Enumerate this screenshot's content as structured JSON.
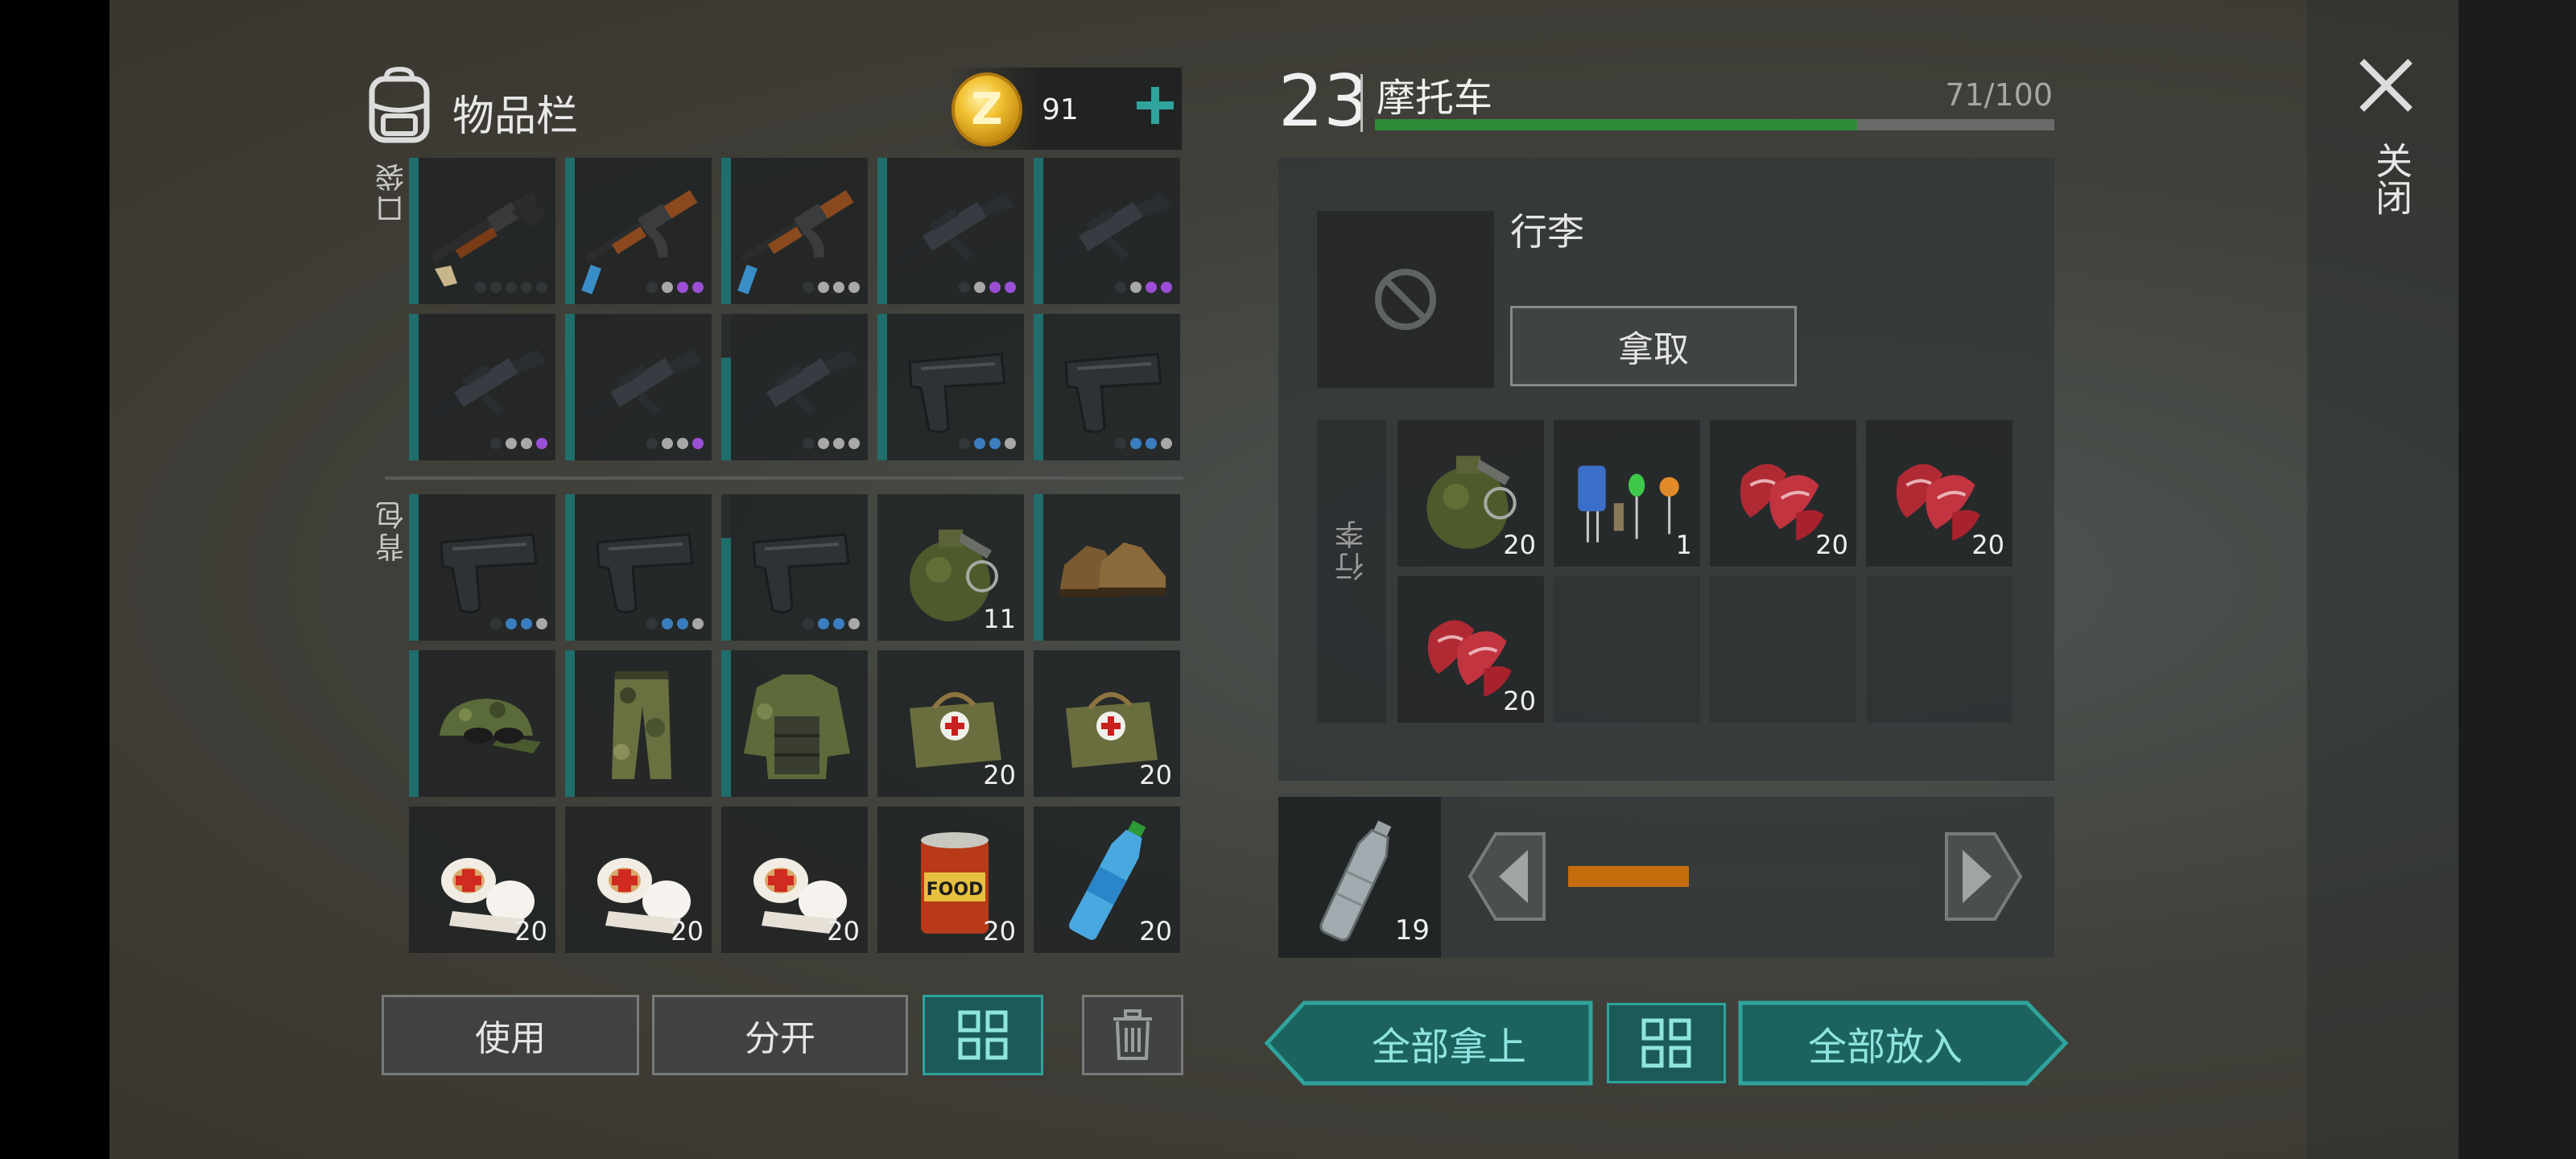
{
  "inventory": {
    "title": "物品栏",
    "coins": "91",
    "pocket_label": "口袋",
    "backpack_label": "背包",
    "pockets": [
      {
        "item": "shotgun",
        "dots": [
          "dark",
          "dark",
          "dark",
          "dark",
          "dark"
        ]
      },
      {
        "item": "ak-rifle",
        "dots": [
          "dark",
          "grey",
          "purple",
          "purple"
        ]
      },
      {
        "item": "ak-rifle",
        "dots": [
          "dark",
          "grey",
          "grey",
          "grey"
        ]
      },
      {
        "item": "m16-rifle",
        "dots": [
          "dark",
          "grey",
          "purple",
          "purple"
        ]
      },
      {
        "item": "m16-rifle",
        "dots": [
          "dark",
          "grey",
          "purple",
          "purple"
        ]
      },
      {
        "item": "m16-rifle",
        "dots": [
          "dark",
          "grey",
          "grey",
          "purple"
        ]
      },
      {
        "item": "m16-rifle",
        "dots": [
          "dark",
          "grey",
          "grey",
          "purple"
        ]
      },
      {
        "item": "m16-rifle",
        "dots": [
          "dark",
          "grey",
          "grey",
          "grey"
        ],
        "partial": true
      },
      {
        "item": "pistol",
        "dots": [
          "dark",
          "blue",
          "blue",
          "grey"
        ]
      },
      {
        "item": "pistol",
        "dots": [
          "dark",
          "blue",
          "blue",
          "grey"
        ]
      }
    ],
    "backpack": [
      {
        "item": "pistol",
        "dots": [
          "dark",
          "blue",
          "blue",
          "grey"
        ]
      },
      {
        "item": "pistol",
        "dots": [
          "dark",
          "blue",
          "blue",
          "grey"
        ]
      },
      {
        "item": "pistol",
        "dots": [
          "dark",
          "blue",
          "blue",
          "grey"
        ],
        "partial": true
      },
      {
        "item": "grenade",
        "qty": "11",
        "norarity": true
      },
      {
        "item": "boots"
      },
      {
        "item": "camo-cap"
      },
      {
        "item": "camo-pants"
      },
      {
        "item": "camo-vest"
      },
      {
        "item": "medkit-bag",
        "qty": "20",
        "norarity": true
      },
      {
        "item": "medkit-bag",
        "qty": "20",
        "norarity": true
      },
      {
        "item": "bandage",
        "qty": "20",
        "norarity": true
      },
      {
        "item": "bandage",
        "qty": "20",
        "norarity": true
      },
      {
        "item": "bandage",
        "qty": "20",
        "norarity": true
      },
      {
        "item": "canned-food",
        "qty": "20",
        "norarity": true
      },
      {
        "item": "water-bottle",
        "qty": "20",
        "norarity": true
      }
    ],
    "buttons": {
      "use": "使用",
      "split": "分开"
    }
  },
  "container": {
    "level": "23",
    "name": "摩托车",
    "durability_text": "71/100",
    "durability": 71,
    "durability_max": 100,
    "bag_label": "行李",
    "take_button": "拿取",
    "side_label": "行李",
    "items": [
      {
        "item": "grenade",
        "qty": "20"
      },
      {
        "item": "electronics",
        "qty": "1"
      },
      {
        "item": "raw-meat",
        "qty": "20"
      },
      {
        "item": "raw-meat",
        "qty": "20"
      },
      {
        "item": "raw-meat",
        "qty": "20"
      }
    ],
    "bottle_qty": "19",
    "slider_fraction": 0.34,
    "take_all": "全部拿上",
    "put_all": "全部放入"
  },
  "close_label": "关闭",
  "colors": {
    "accent": "#2fa39c",
    "durability": "#2e8c36",
    "slider": "#c56d0c"
  }
}
